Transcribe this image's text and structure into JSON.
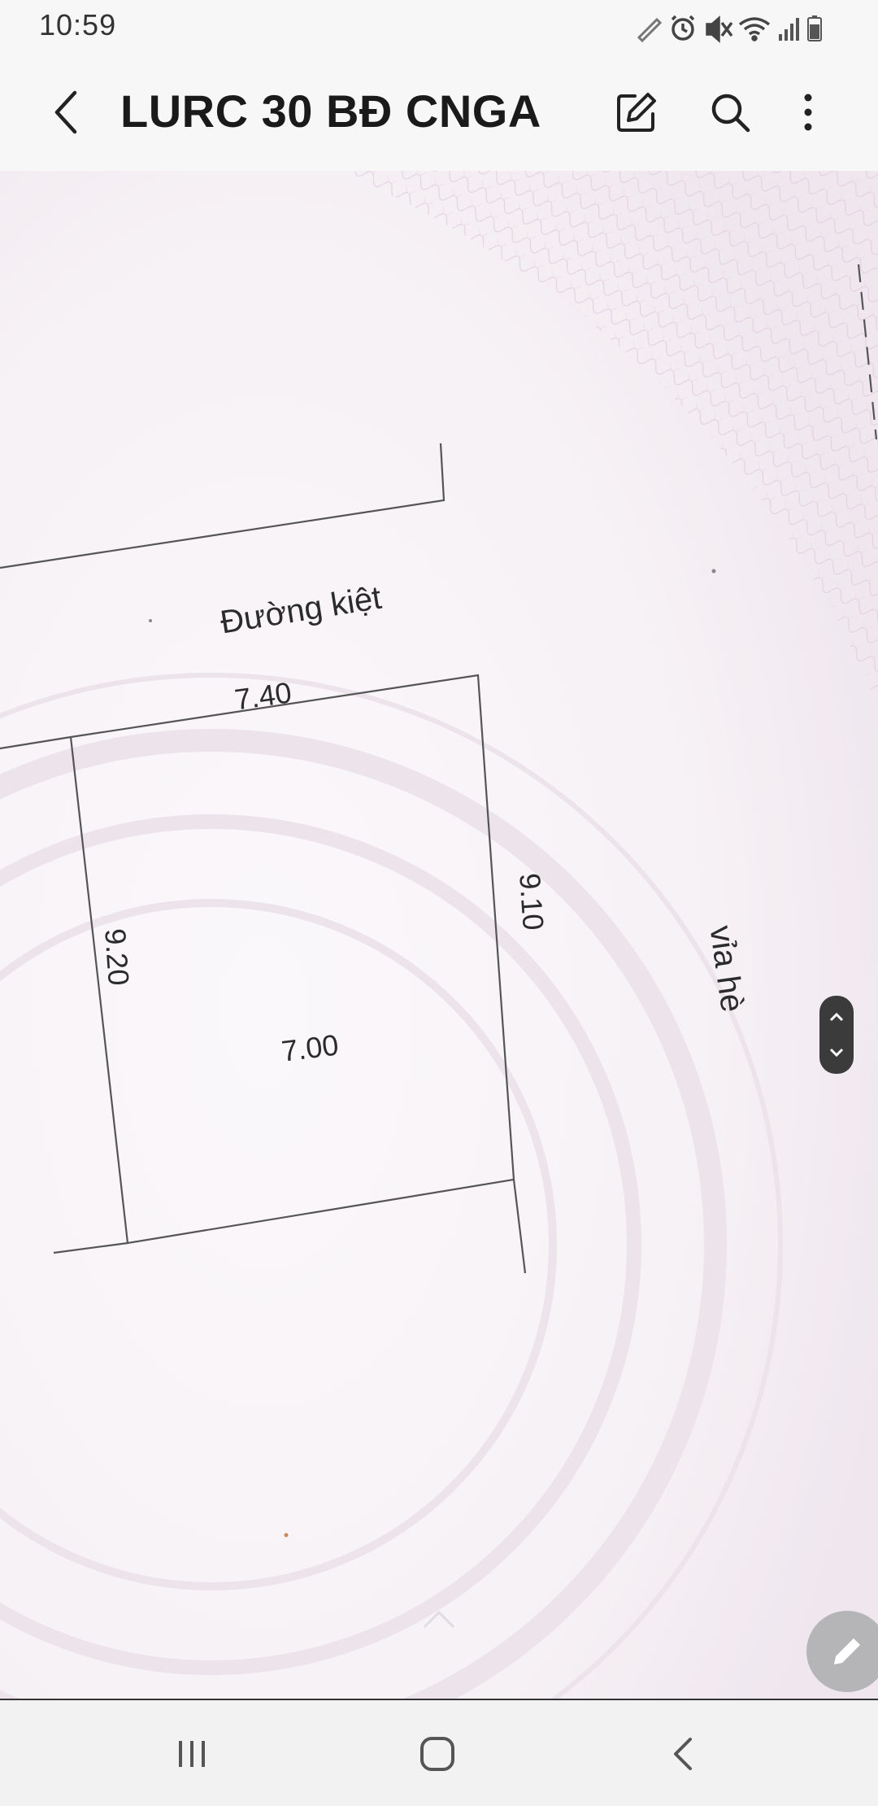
{
  "status_bar": {
    "time": "10:59",
    "icons": [
      "pen-icon",
      "alarm-icon",
      "mute-icon",
      "wifi-icon",
      "signal-icon",
      "battery-icon"
    ]
  },
  "app_bar": {
    "title": "LURC 30 BĐ CNGA",
    "icons": [
      "back-arrow-icon",
      "edit-note-icon",
      "search-icon",
      "more-vert-icon"
    ]
  },
  "document": {
    "road_label": "Đường kiệt",
    "top_dimension": "7.40",
    "right_dimension": "9.10",
    "left_dimension": "9.20",
    "bottom_dimension": "7.00",
    "sidewalk_label": "vỉa hè"
  },
  "colors": {
    "bars": "#f7f7f7",
    "document_background": "#f4f0f4",
    "pattern": "#e6d6e4",
    "lines": "#555555",
    "scroll_handle": "#3b3b3b",
    "fab": "#b5b5b8"
  },
  "nav_bar": {
    "icons": [
      "recents-icon",
      "home-icon",
      "nav-back-icon"
    ]
  }
}
